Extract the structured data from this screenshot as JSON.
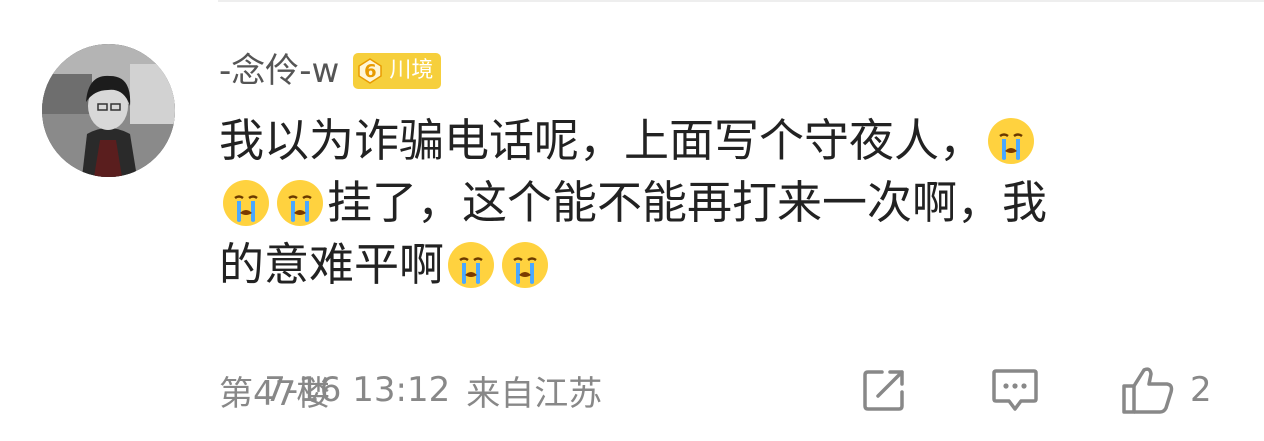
{
  "comment": {
    "username": "-念伶-w",
    "badge": {
      "level": "6",
      "label": "川境",
      "color": "#f6cf3c"
    },
    "lines": [
      {
        "text": "我以为诈骗电话呢，上面写个守夜人，",
        "emojis_after": 1,
        "emojis_before": 0
      },
      {
        "text": "挂了，这个能不能再打来一次啊，我",
        "emojis_before": 2,
        "emojis_after": 0
      },
      {
        "text": "的意难平啊",
        "emojis_before": 0,
        "emojis_after": 2
      }
    ],
    "emoji_icon": "crying-face-icon",
    "footer": {
      "floor": "第47楼",
      "datetime": "7-16 13:12",
      "location": "来自江苏"
    },
    "actions": {
      "share_icon": "share-icon",
      "reply_icon": "comment-icon",
      "like_icon": "thumbs-up-icon",
      "like_count": "2"
    }
  }
}
